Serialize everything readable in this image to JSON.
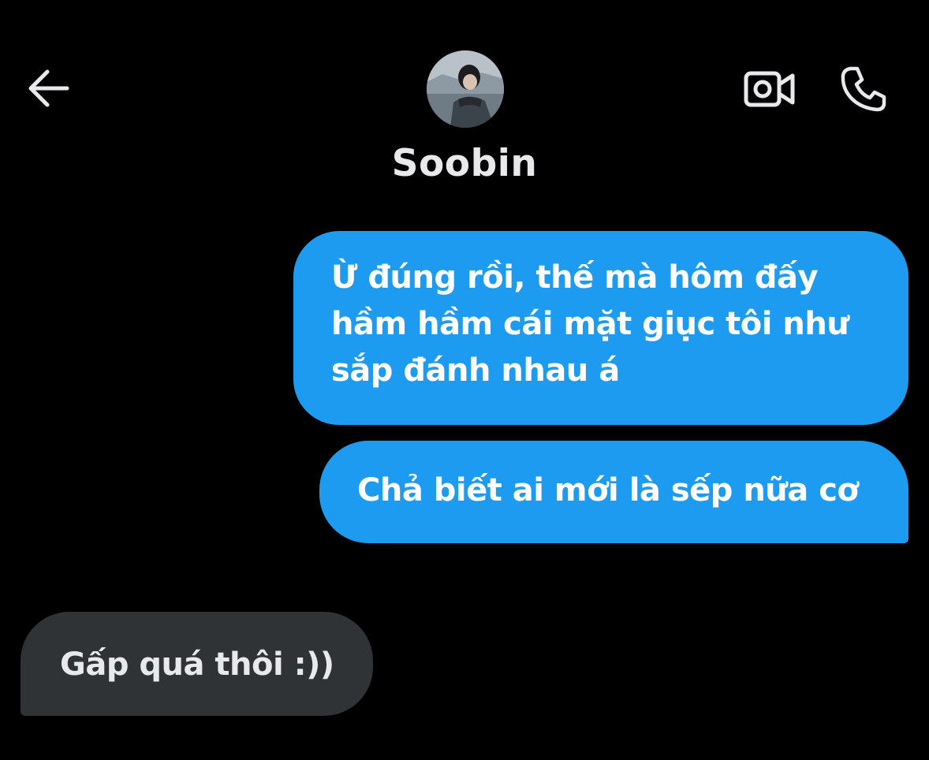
{
  "header": {
    "back_icon": "arrow-left-icon",
    "video_icon": "video-camera-icon",
    "call_icon": "phone-icon",
    "contact_name": "Soobin"
  },
  "messages": [
    {
      "direction": "outgoing",
      "text": "Ừ đúng rồi, thế mà hôm đấy\nhầm hầm cái mặt giục tôi như\nsắp đánh nhau á"
    },
    {
      "direction": "outgoing",
      "text": "Chả biết ai mới là sếp nữa cơ"
    },
    {
      "direction": "incoming",
      "text": "Gấp quá thôi :))"
    }
  ],
  "colors": {
    "background": "#000000",
    "outgoing_bubble": "#1d9bf0",
    "incoming_bubble": "#2f3336",
    "text": "#e7e9ea"
  }
}
